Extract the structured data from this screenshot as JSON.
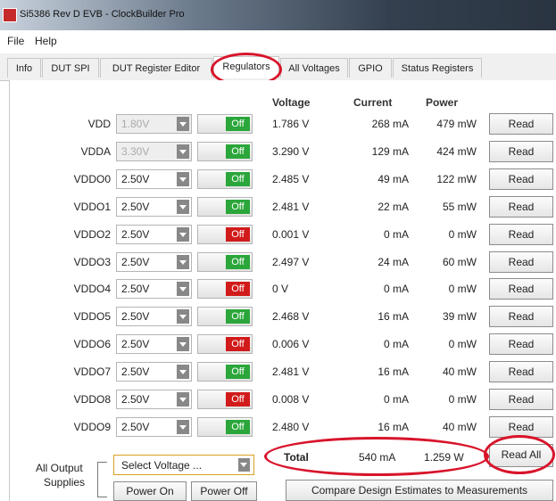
{
  "window": {
    "title": "Si5386 Rev D EVB - ClockBuilder Pro"
  },
  "menu": {
    "file": "File",
    "help": "Help"
  },
  "tabs": [
    "Info",
    "DUT SPI",
    "DUT Register Editor",
    "Regulators",
    "All Voltages",
    "GPIO",
    "Status Registers"
  ],
  "active_tab": "Regulators",
  "headers": {
    "voltage": "Voltage",
    "current": "Current",
    "power": "Power"
  },
  "rows": [
    {
      "name": "VDD",
      "setting": "1.80V",
      "state": "Off",
      "voltage": "1.786 V",
      "current": "268 mA",
      "power": "479 mW",
      "read": "Read"
    },
    {
      "name": "VDDA",
      "setting": "3.30V",
      "state": "Off",
      "voltage": "3.290 V",
      "current": "129 mA",
      "power": "424 mW",
      "read": "Read"
    },
    {
      "name": "VDDO0",
      "setting": "2.50V",
      "state": "Off",
      "voltage": "2.485 V",
      "current": "49 mA",
      "power": "122 mW",
      "read": "Read"
    },
    {
      "name": "VDDO1",
      "setting": "2.50V",
      "state": "Off",
      "voltage": "2.481 V",
      "current": "22 mA",
      "power": "55 mW",
      "read": "Read"
    },
    {
      "name": "VDDO2",
      "setting": "2.50V",
      "state": "Off",
      "voltage": "0.001 V",
      "current": "0 mA",
      "power": "0 mW",
      "read": "Read"
    },
    {
      "name": "VDDO3",
      "setting": "2.50V",
      "state": "Off",
      "voltage": "2.497 V",
      "current": "24 mA",
      "power": "60 mW",
      "read": "Read"
    },
    {
      "name": "VDDO4",
      "setting": "2.50V",
      "state": "Off",
      "voltage": "0 V",
      "current": "0 mA",
      "power": "0 mW",
      "read": "Read"
    },
    {
      "name": "VDDO5",
      "setting": "2.50V",
      "state": "Off",
      "voltage": "2.468 V",
      "current": "16 mA",
      "power": "39 mW",
      "read": "Read"
    },
    {
      "name": "VDDO6",
      "setting": "2.50V",
      "state": "Off",
      "voltage": "0.006 V",
      "current": "0 mA",
      "power": "0 mW",
      "read": "Read"
    },
    {
      "name": "VDDO7",
      "setting": "2.50V",
      "state": "Off",
      "voltage": "2.481 V",
      "current": "16 mA",
      "power": "40 mW",
      "read": "Read"
    },
    {
      "name": "VDDO8",
      "setting": "2.50V",
      "state": "Off",
      "voltage": "0.008 V",
      "current": "0 mA",
      "power": "0 mW",
      "read": "Read"
    },
    {
      "name": "VDDO9",
      "setting": "2.50V",
      "state": "Off",
      "voltage": "2.480 V",
      "current": "16 mA",
      "power": "40 mW",
      "read": "Read"
    }
  ],
  "switch_colors": [
    "#2ba63a",
    "#2ba63a",
    "#2ba63a",
    "#2ba63a",
    "#d11b1b",
    "#2ba63a",
    "#d11b1b",
    "#2ba63a",
    "#d11b1b",
    "#2ba63a",
    "#d11b1b",
    "#2ba63a"
  ],
  "total": {
    "label": "Total",
    "current": "540 mA",
    "power": "1.259 W"
  },
  "read_all": "Read All",
  "all_output": {
    "label_line1": "All Output",
    "label_line2": "Supplies",
    "select_placeholder": "Select Voltage ...",
    "power_on": "Power On",
    "power_off": "Power Off"
  },
  "compare": "Compare Design Estimates to Measurements",
  "colors": {
    "highlight": "#d8142b",
    "on": "#2ba63a",
    "off": "#d11b1b"
  }
}
